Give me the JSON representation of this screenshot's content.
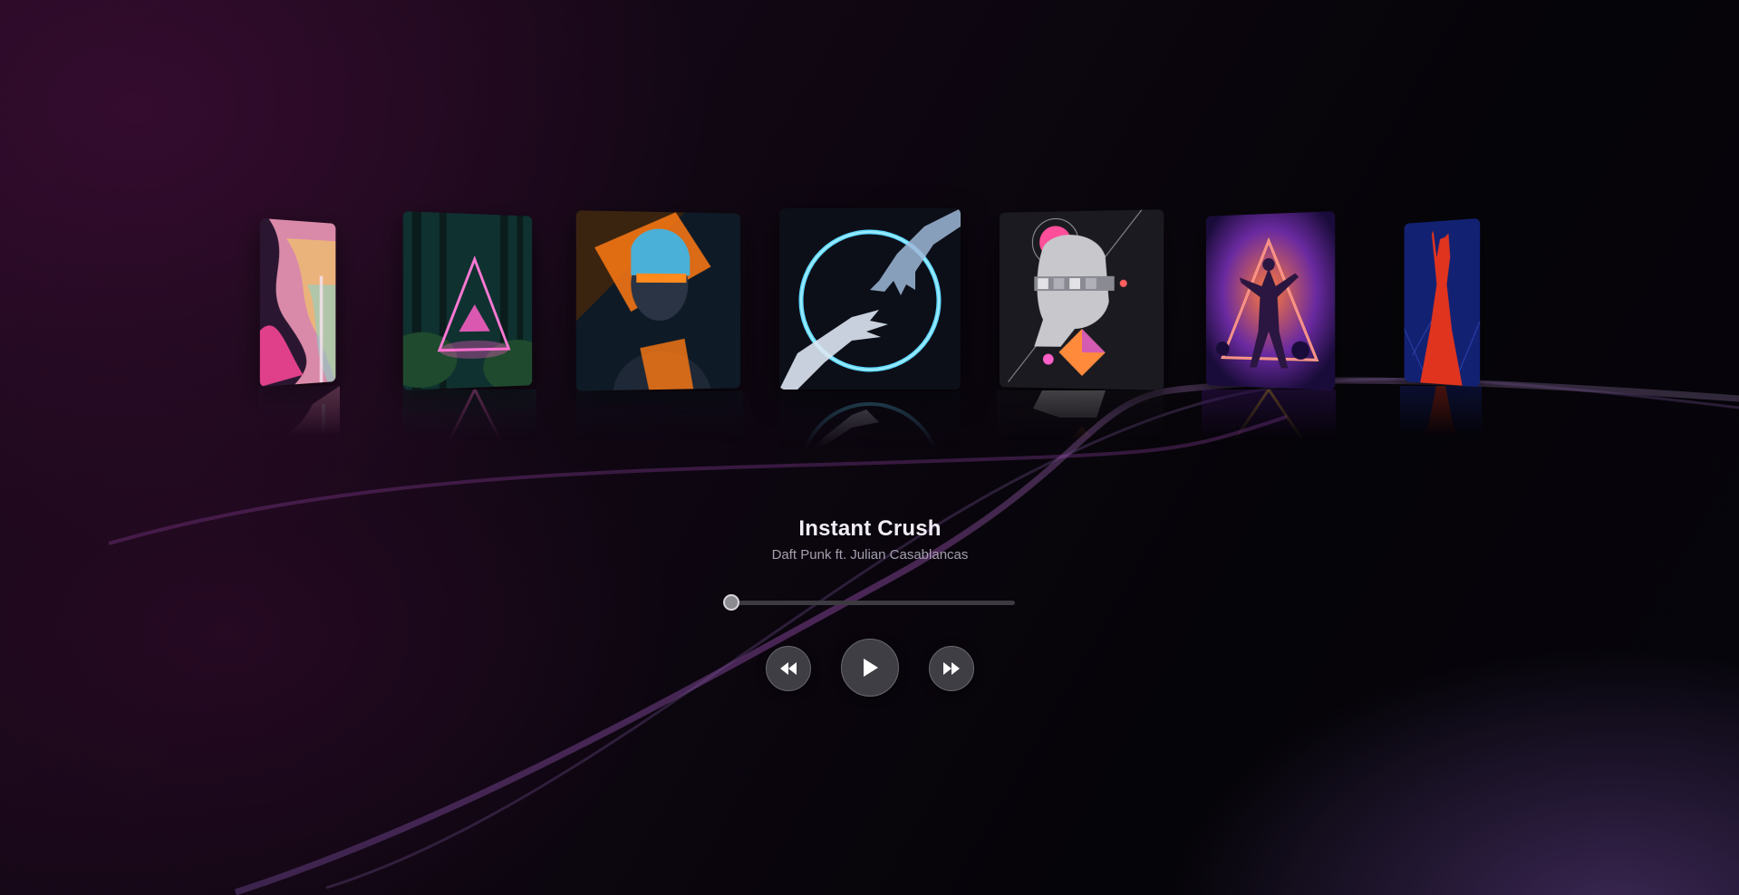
{
  "player": {
    "now_playing": {
      "title": "Instant Crush",
      "artist": "Daft Punk ft. Julian Casablancas"
    },
    "progress_fraction": 0.0,
    "controls": {
      "rewind_icon": "rewind-icon",
      "play_icon": "play-icon",
      "forward_icon": "fast-forward-icon"
    }
  },
  "carousel": {
    "albums": [
      {
        "art": "abstract-fluid-art"
      },
      {
        "art": "neon-triangle-forest-art"
      },
      {
        "art": "orange-light-portrait-art"
      },
      {
        "art": "neon-circle-hands-art"
      },
      {
        "art": "statue-geometric-collage-art"
      },
      {
        "art": "neon-triangle-dancer-art"
      },
      {
        "art": "red-dancer-blue-art"
      }
    ]
  },
  "colors": {
    "accent_purple": "#9a4fb0",
    "neon_blue": "#5fd8ff",
    "neon_pink": "#ff5fc8",
    "background": "#07050c"
  }
}
